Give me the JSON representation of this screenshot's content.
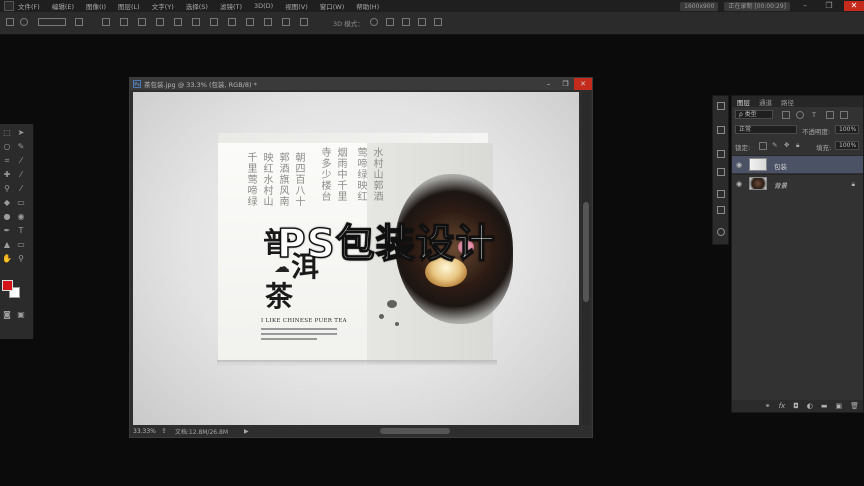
{
  "menubar": {
    "items": [
      "文件(F)",
      "编辑(E)",
      "图像(I)",
      "图层(L)",
      "文字(Y)",
      "选择(S)",
      "滤镜(T)",
      "3D(D)",
      "视图(V)",
      "窗口(W)",
      "帮助(H)"
    ],
    "recording": "1600x900",
    "recording_status": "正在录制 [00:00:29]"
  },
  "optionsbar": {
    "mode_3d": "3D 模式："
  },
  "document": {
    "title": "茶包装.jpg @ 33.3% (包装, RGB/8) *",
    "zoom": "33.33%",
    "doc_size": "文档:12.8M/26.8M",
    "overlay_title": "PS包装设计",
    "artwork": {
      "brand_line1": "普",
      "brand_line2": "洱",
      "brand_line3": "茶",
      "english": "I LIKE CHINESE  PUER TEA"
    }
  },
  "layers_panel": {
    "tabs": [
      "图层",
      "通道",
      "路径"
    ],
    "filter_kind": "ρ 类型",
    "blend_mode": "正常",
    "opacity_label": "不透明度:",
    "opacity_value": "100%",
    "lock_label": "锁定:",
    "fill_label": "填充:",
    "fill_value": "100%",
    "layers": [
      {
        "name": "包装",
        "selected": true
      },
      {
        "name": "背景",
        "locked": true
      }
    ]
  },
  "colors": {
    "foreground": "#d21416",
    "background": "#ffffff",
    "close_red": "#c42b1c",
    "selected_layer": "#4b5266"
  }
}
